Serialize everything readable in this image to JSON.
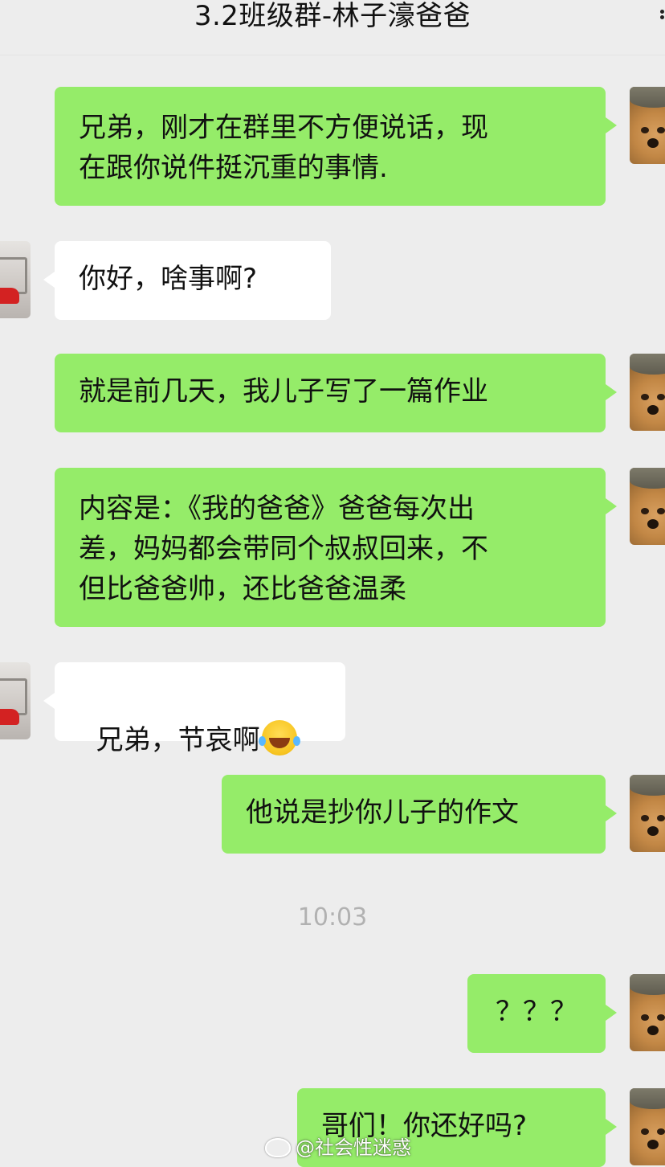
{
  "header": {
    "title": "3.2班级群-林子濠爸爸",
    "more_icon": "more-dots-icon"
  },
  "messages": [
    {
      "side": "mine",
      "text": "兄弟，刚才在群里不方便说话，现\n在跟你说件挺沉重的事情."
    },
    {
      "side": "theirs",
      "text": "你好，啥事啊?"
    },
    {
      "side": "mine",
      "text": "就是前几天，我儿子写了一篇作业"
    },
    {
      "side": "mine",
      "text": "内容是：《我的爸爸》爸爸每次出\n差，妈妈都会带同个叔叔回来，不\n但比爸爸帅，还比爸爸温柔"
    },
    {
      "side": "theirs",
      "text": "兄弟，节哀啊",
      "emoji": "laugh-cry-emoji"
    },
    {
      "side": "mine",
      "text": "他说是抄你儿子的作文"
    },
    {
      "side": "mine",
      "text": "？？？"
    },
    {
      "side": "mine",
      "text": "哥们！你还好吗?"
    }
  ],
  "timestamp": "10:03",
  "watermark": "@社会性迷惑",
  "avatars": {
    "mine": "dog-avatar",
    "theirs": "car-avatar"
  },
  "colors": {
    "background": "#ededed",
    "mine_bubble": "#95ec69",
    "theirs_bubble": "#ffffff",
    "timestamp": "#b1b1b1"
  }
}
